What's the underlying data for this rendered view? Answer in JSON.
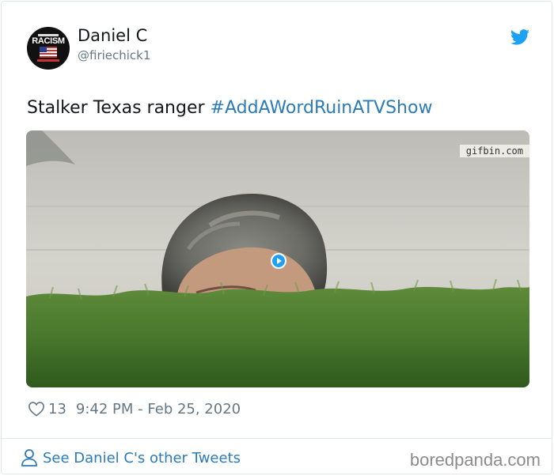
{
  "author": {
    "name": "Daniel C",
    "handle": "@firiechick1",
    "avatar_text": "RACISM"
  },
  "tweet": {
    "text": "Stalker Texas ranger ",
    "hashtag": "#AddAWordRuinATVShow"
  },
  "media": {
    "watermark": "gifbin.com",
    "type": "gif",
    "play_icon": "play-icon"
  },
  "meta": {
    "likes": "13",
    "timestamp": "9:42 PM - Feb 25, 2020"
  },
  "footer": {
    "see_more": "See Daniel C's other Tweets",
    "brand": "boredpanda.com"
  },
  "colors": {
    "link": "#2b7bb9",
    "secondary_text": "#657786",
    "twitter_blue": "#1da1f2"
  }
}
